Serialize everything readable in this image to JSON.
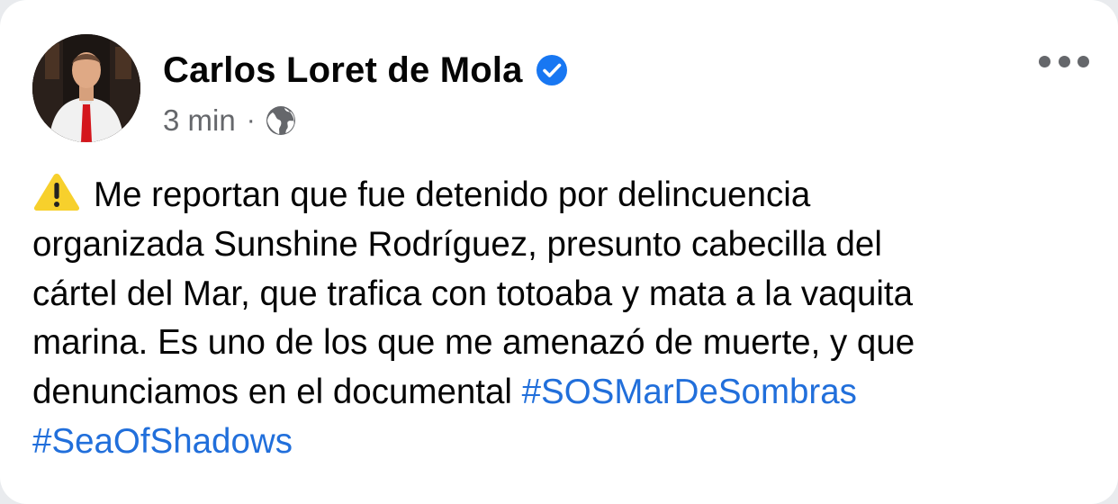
{
  "post": {
    "author": "Carlos Loret de Mola",
    "verified": true,
    "timestamp": "3 min",
    "separator": "·",
    "privacy_icon": "globe-icon",
    "menu_icon": "more-options-icon",
    "warning_icon": "warning-icon",
    "lines": [
      "Me reportan que fue detenido por delincuencia",
      "organizada Sunshine Rodríguez, presunto cabecilla del",
      "cártel del Mar, que trafica con totoaba y mata a la vaquita",
      "marina. Es uno de los que me amenazó de muerte, y que",
      "denunciamos en el documental "
    ],
    "hashtags": [
      "#SOSMarDeSombras",
      "#SeaOfShadows"
    ]
  },
  "colors": {
    "text": "#050505",
    "secondary": "#65676b",
    "link": "#216fdb",
    "verified": "#1877f2",
    "warning": "#f7d02c"
  }
}
